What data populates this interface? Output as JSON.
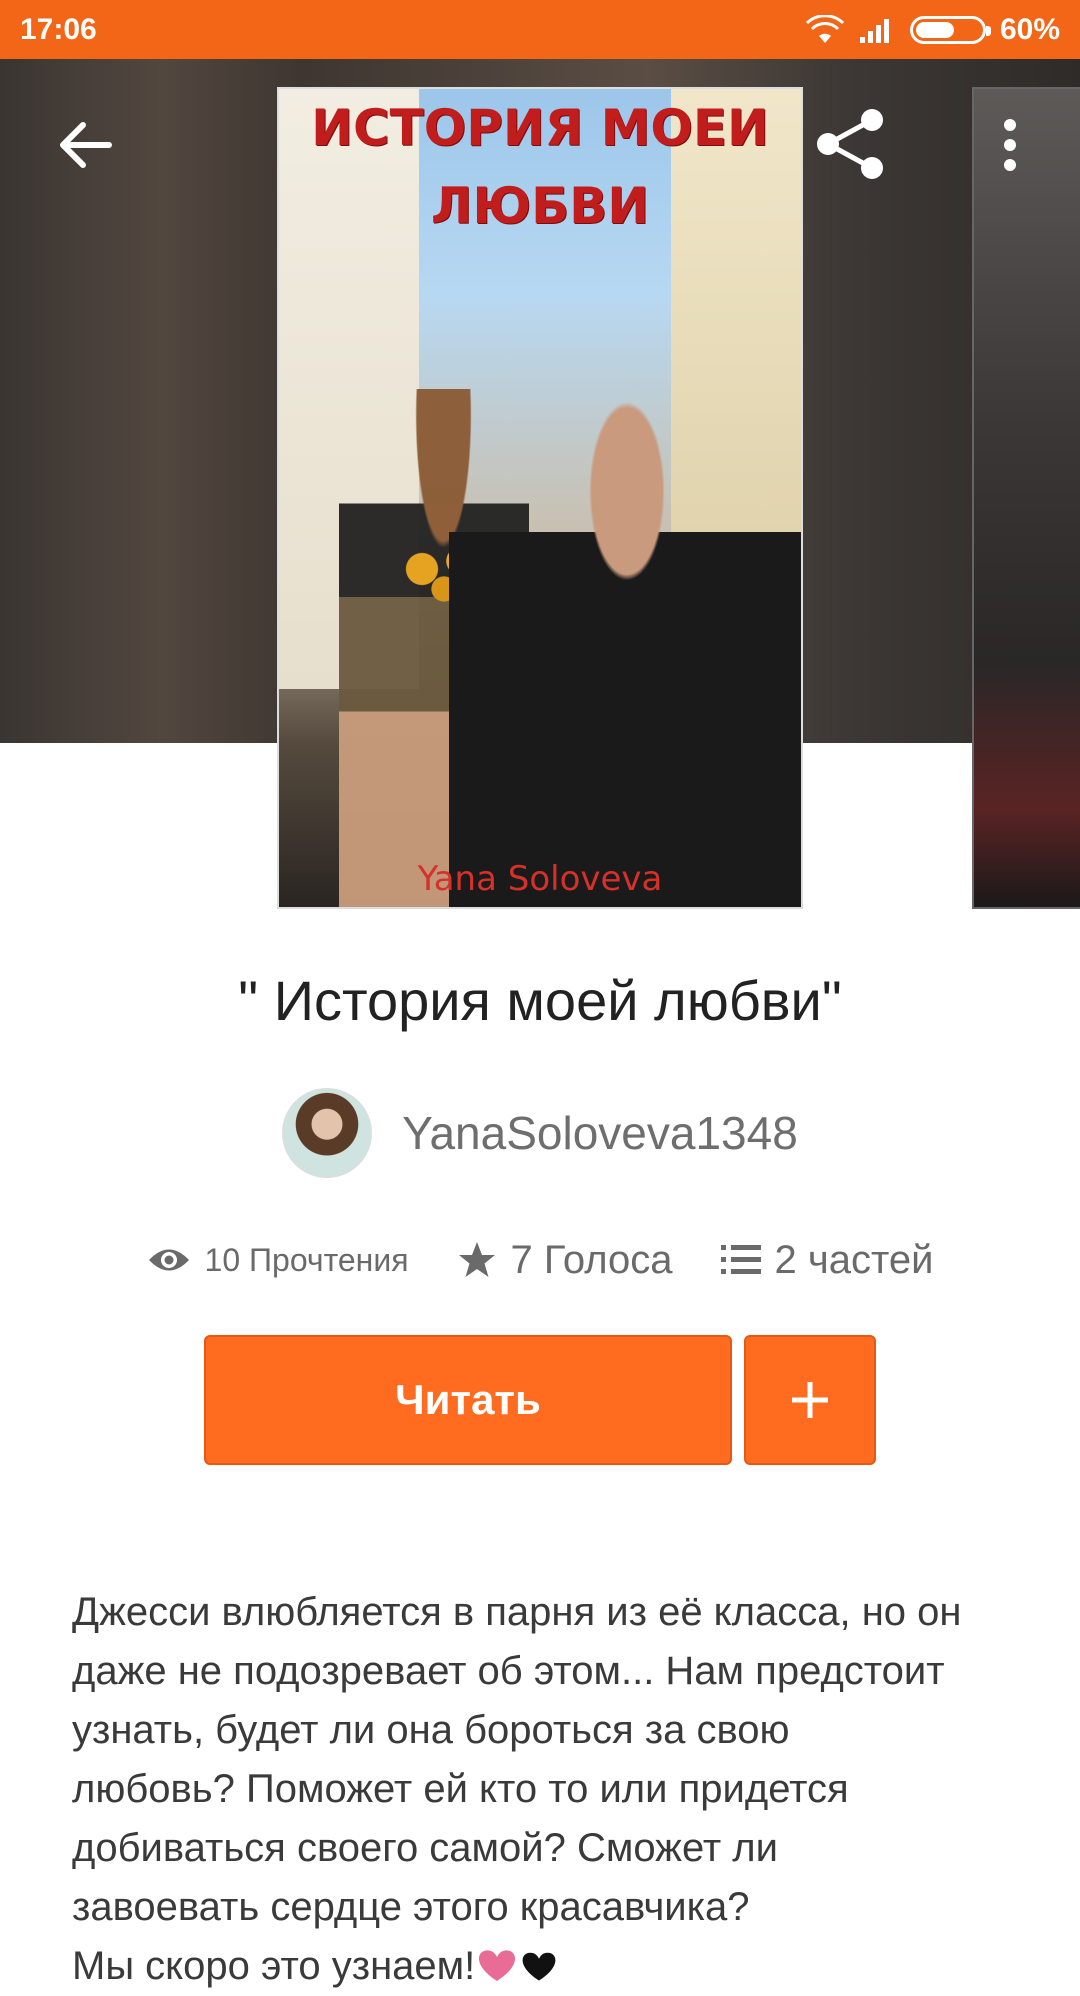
{
  "status_bar": {
    "time": "17:06",
    "battery": "60%",
    "battery_level": 0.6
  },
  "header": {
    "back_icon": "arrow-left-icon",
    "share_icon": "share-icon",
    "more_icon": "more-vertical-icon"
  },
  "cover": {
    "title_line1": "ИСТОРИЯ МОЕИ",
    "title_line2": "ЛЮБВИ",
    "author": "Yana Soloveva"
  },
  "book": {
    "title": "\" История моей любви\"",
    "author_name": "YanaSoloveva1348"
  },
  "stats": {
    "reads": "10 Прочтения",
    "votes": "7 Голоса",
    "parts": "2 частей"
  },
  "actions": {
    "read_label": "Читать",
    "add_icon": "plus-icon"
  },
  "description": "Джесси влюбляется в парня из её класса, но он\nдаже не подозревает об этом... Нам предстоит\nузнать, будет ли  она бороться за  свою\nлюбовь? Поможет ей кто то или придется\nдобиваться своего самой? Сможет ли\nзавоевать сердце этого красавчика?\n   Мы скоро это узнаем!",
  "colors": {
    "accent": "#ff6b1f",
    "status_bar": "#f46617"
  }
}
